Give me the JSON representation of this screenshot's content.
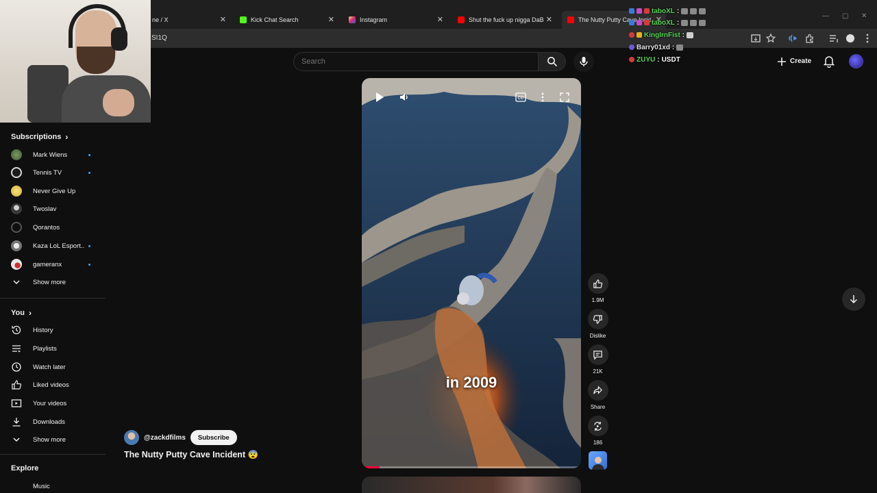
{
  "browser": {
    "tabs": [
      {
        "label": "ne / X",
        "favicon_color": "#000000"
      },
      {
        "label": "Kick Chat Search",
        "favicon_color": "#53fc18"
      },
      {
        "label": "Instagram",
        "favicon_color": "#e1306c"
      },
      {
        "label": "Shut the fuck up nigga DaBaby",
        "favicon_color": "#ff0000"
      },
      {
        "label": "The Nutty Putty Cave Incident",
        "favicon_color": "#ff0000"
      }
    ],
    "url_fragment": "SI1Q"
  },
  "header": {
    "search_placeholder": "Search",
    "create_label": "Create"
  },
  "chat": {
    "messages": [
      {
        "user": "taboXL",
        "text": "",
        "color": "#57d657"
      },
      {
        "user": "taboXL",
        "text": "",
        "color": "#57d657"
      },
      {
        "user": "KingIrnFist",
        "text": "",
        "color": "#57d657"
      },
      {
        "user": "Barry01xd",
        "text": "",
        "color": "#e0e0e0"
      },
      {
        "user": "ZUYU",
        "text": "USDT",
        "color": "#57d657"
      }
    ]
  },
  "sidebar": {
    "subscriptions_title": "Subscriptions",
    "subscriptions": [
      {
        "name": "Mark Wiens",
        "new": true
      },
      {
        "name": "Tennis TV",
        "new": true
      },
      {
        "name": "Never Give Up",
        "new": false
      },
      {
        "name": "Twoslav",
        "new": false
      },
      {
        "name": "Qorantos",
        "new": false
      },
      {
        "name": "Kaza LoL Esport...",
        "new": true
      },
      {
        "name": "gameranx",
        "new": true
      }
    ],
    "show_more": "Show more",
    "you_title": "You",
    "you_items": [
      {
        "name": "History",
        "icon": "history-icon"
      },
      {
        "name": "Playlists",
        "icon": "playlists-icon"
      },
      {
        "name": "Watch later",
        "icon": "watch-later-icon"
      },
      {
        "name": "Liked videos",
        "icon": "liked-videos-icon"
      },
      {
        "name": "Your videos",
        "icon": "your-videos-icon"
      },
      {
        "name": "Downloads",
        "icon": "downloads-icon"
      }
    ],
    "show_more_2": "Show more",
    "explore_title": "Explore",
    "explore_first": "Music"
  },
  "video": {
    "caption": "in 2009",
    "progress": 0.08,
    "channel": "@zackdfilms",
    "subscribe_label": "Subscribe",
    "title": "The Nutty Putty Cave Incident 😨"
  },
  "actions": {
    "likes": "1.9M",
    "dislike_label": "Dislike",
    "comments": "21K",
    "share_label": "Share",
    "remix_count": "186"
  },
  "colors": {
    "accent": "#ff0033",
    "new_dot": "#3ea6ff",
    "background": "#0f0f0f"
  }
}
